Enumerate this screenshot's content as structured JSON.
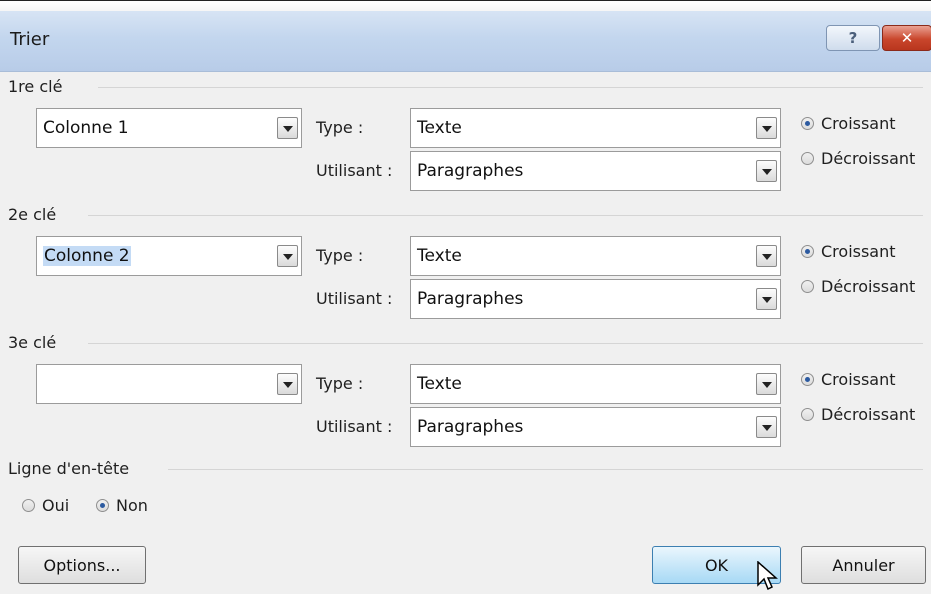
{
  "dialog": {
    "title": "Trier"
  },
  "keys": [
    {
      "label": "1re clé",
      "column": "Colonne 1",
      "type_label": "Type :",
      "type_value": "Texte",
      "using_label": "Utilisant :",
      "using_value": "Paragraphes",
      "asc": "Croissant",
      "desc": "Décroissant",
      "selected": "asc"
    },
    {
      "label": "2e clé",
      "column": "Colonne 2",
      "type_label": "Type :",
      "type_value": "Texte",
      "using_label": "Utilisant :",
      "using_value": "Paragraphes",
      "asc": "Croissant",
      "desc": "Décroissant",
      "selected": "asc"
    },
    {
      "label": "3e clé",
      "column": "",
      "type_label": "Type :",
      "type_value": "Texte",
      "using_label": "Utilisant :",
      "using_value": "Paragraphes",
      "asc": "Croissant",
      "desc": "Décroissant",
      "selected": "asc"
    }
  ],
  "header_row": {
    "label": "Ligne d'en-tête",
    "yes": "Oui",
    "no": "Non",
    "selected": "no"
  },
  "buttons": {
    "options": "Options...",
    "ok": "OK",
    "cancel": "Annuler"
  },
  "icons": {
    "help": "?",
    "close": "✕"
  },
  "colors": {
    "titlebar": "#c3d6ee",
    "close": "#c9462c",
    "radio_selected": "#2c5aa0",
    "selection": "#c4dbf5"
  }
}
